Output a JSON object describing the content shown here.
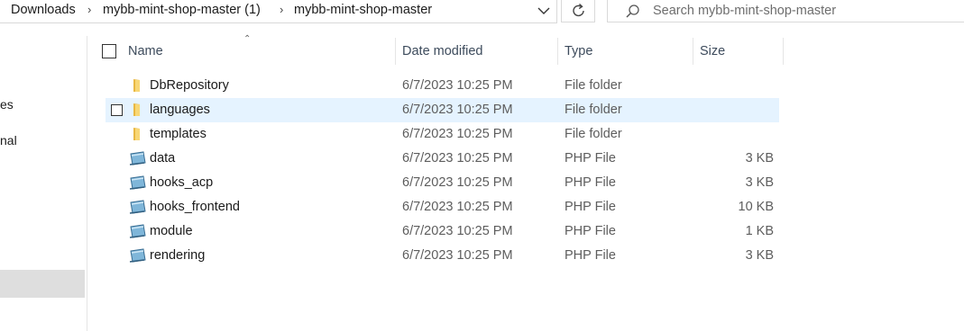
{
  "breadcrumb": {
    "items": [
      "Downloads",
      "mybb-mint-shop-master (1)",
      "mybb-mint-shop-master"
    ]
  },
  "search": {
    "placeholder": "Search mybb-mint-shop-master"
  },
  "nav": {
    "items": [
      "es",
      "nal"
    ]
  },
  "columns": {
    "name": "Name",
    "date": "Date modified",
    "type": "Type",
    "size": "Size"
  },
  "files": [
    {
      "name": "DbRepository",
      "date": "6/7/2023 10:25 PM",
      "type": "File folder",
      "size": "",
      "icon": "folder-icon"
    },
    {
      "name": "languages",
      "date": "6/7/2023 10:25 PM",
      "type": "File folder",
      "size": "",
      "icon": "folder-icon"
    },
    {
      "name": "templates",
      "date": "6/7/2023 10:25 PM",
      "type": "File folder",
      "size": "",
      "icon": "folder-icon"
    },
    {
      "name": "data",
      "date": "6/7/2023 10:25 PM",
      "type": "PHP File",
      "size": "3 KB",
      "icon": "php-file-icon"
    },
    {
      "name": "hooks_acp",
      "date": "6/7/2023 10:25 PM",
      "type": "PHP File",
      "size": "3 KB",
      "icon": "php-file-icon"
    },
    {
      "name": "hooks_frontend",
      "date": "6/7/2023 10:25 PM",
      "type": "PHP File",
      "size": "10 KB",
      "icon": "php-file-icon"
    },
    {
      "name": "module",
      "date": "6/7/2023 10:25 PM",
      "type": "PHP File",
      "size": "1 KB",
      "icon": "php-file-icon"
    },
    {
      "name": "rendering",
      "date": "6/7/2023 10:25 PM",
      "type": "PHP File",
      "size": "3 KB",
      "icon": "php-file-icon"
    }
  ],
  "colors": {
    "hover_row": "#e5f3ff",
    "folder": "#f8d775",
    "nav_selected": "#dedede"
  }
}
